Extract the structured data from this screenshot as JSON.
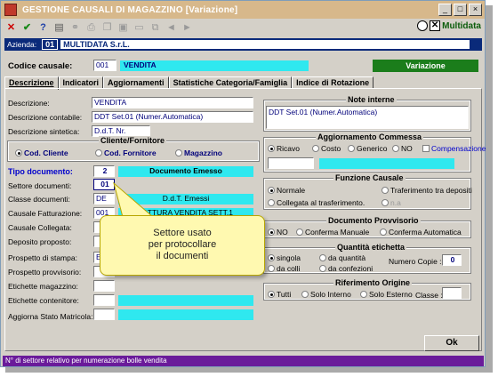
{
  "window": {
    "title": "GESTIONE CAUSALI DI MAGAZZINO [Variazione]",
    "minimize": "_",
    "maximize": "□",
    "close": "×",
    "logo": "Multidata"
  },
  "azienda": {
    "label": "Azienda:",
    "code": "01",
    "name": "MULTIDATA S.r.L."
  },
  "codice": {
    "label": "Codice causale:",
    "value": "001",
    "name": "VENDITA",
    "mode": "Variazione"
  },
  "tabs": [
    "Descrizione",
    "Indicatori",
    "Aggiornamenti",
    "Statistiche Categoria/Famiglia",
    "Indice di Rotazione"
  ],
  "left": {
    "descrizione": {
      "label": "Descrizione:",
      "value": "VENDITA"
    },
    "desc_contabile": {
      "label": "Descrizione contabile:",
      "value": "DDT Set.01 (Numer.Automatica)"
    },
    "desc_sintetica": {
      "label": "Descrizione sintetica:",
      "value": "D.d.T. Nr."
    },
    "cliente_fornitore": {
      "title": "Cliente/Fornitore",
      "opt1": "Cod. Cliente",
      "opt2": "Cod. Fornitore",
      "opt3": "Magazzino"
    },
    "tipo_documento": {
      "label": "Tipo documento:",
      "value": "2",
      "desc": "Documento Emesso"
    },
    "settore": {
      "label": "Settore documenti:",
      "value": "01"
    },
    "classe": {
      "label": "Classe documenti:",
      "value": "DE",
      "desc": "D.d.T. Emessi"
    },
    "causale_fatt": {
      "label": "Causale Fatturazione:",
      "value": "001",
      "desc": "FATTURA VENDITA SETT.1"
    },
    "causale_coll": {
      "label": "Causale Collegata:"
    },
    "deposito": {
      "label": "Deposito proposto:"
    },
    "prospetto_stampa": {
      "label": "Prospetto di stampa:",
      "value": "E"
    },
    "prospetto_provv": {
      "label": "Prospetto provvisorio:"
    },
    "etichette_mag": {
      "label": "Etichette magazzino:"
    },
    "etichette_cont": {
      "label": "Etichette contenitore:"
    },
    "aggiorna_stato": {
      "label": "Aggiorna Stato Matricola:"
    }
  },
  "right": {
    "note": {
      "title": "Note interne",
      "value": "DDT Set.01 (Numer.Automatica)"
    },
    "aggiornamento": {
      "title": "Aggiornamento Commessa",
      "opt1": "Ricavo",
      "opt2": "Costo",
      "opt3": "Generico",
      "opt4": "NO",
      "compensazione": "Compensazione"
    },
    "funzione": {
      "title": "Funzione Causale",
      "opt1": "Normale",
      "opt2": "Traferimento tra depositi",
      "opt3": "Collegata al trasferimento.",
      "opt4": "n.a"
    },
    "doc_provv": {
      "title": "Documento Provvisorio",
      "opt1": "NO",
      "opt2": "Conferma Manuale",
      "opt3": "Conferma Automatica"
    },
    "qta_etichetta": {
      "title": "Quantità etichetta",
      "opt1": "singola",
      "opt2": "da quantità",
      "opt3": "da colli",
      "opt4": "da confezioni",
      "copie_label": "Numero Copie :",
      "copie_value": "0"
    },
    "rif_origine": {
      "title": "Riferimento Origine",
      "opt1": "Tutti",
      "opt2": "Solo Interno",
      "opt3": "Solo Esterno",
      "classe_label": "Classe :"
    }
  },
  "ok_label": "Ok",
  "status": "N° di settore relativo per numerazione bolle vendita",
  "callout": {
    "line1": "Settore usato",
    "line2": "per protocollare",
    "line3": "il documenti"
  }
}
